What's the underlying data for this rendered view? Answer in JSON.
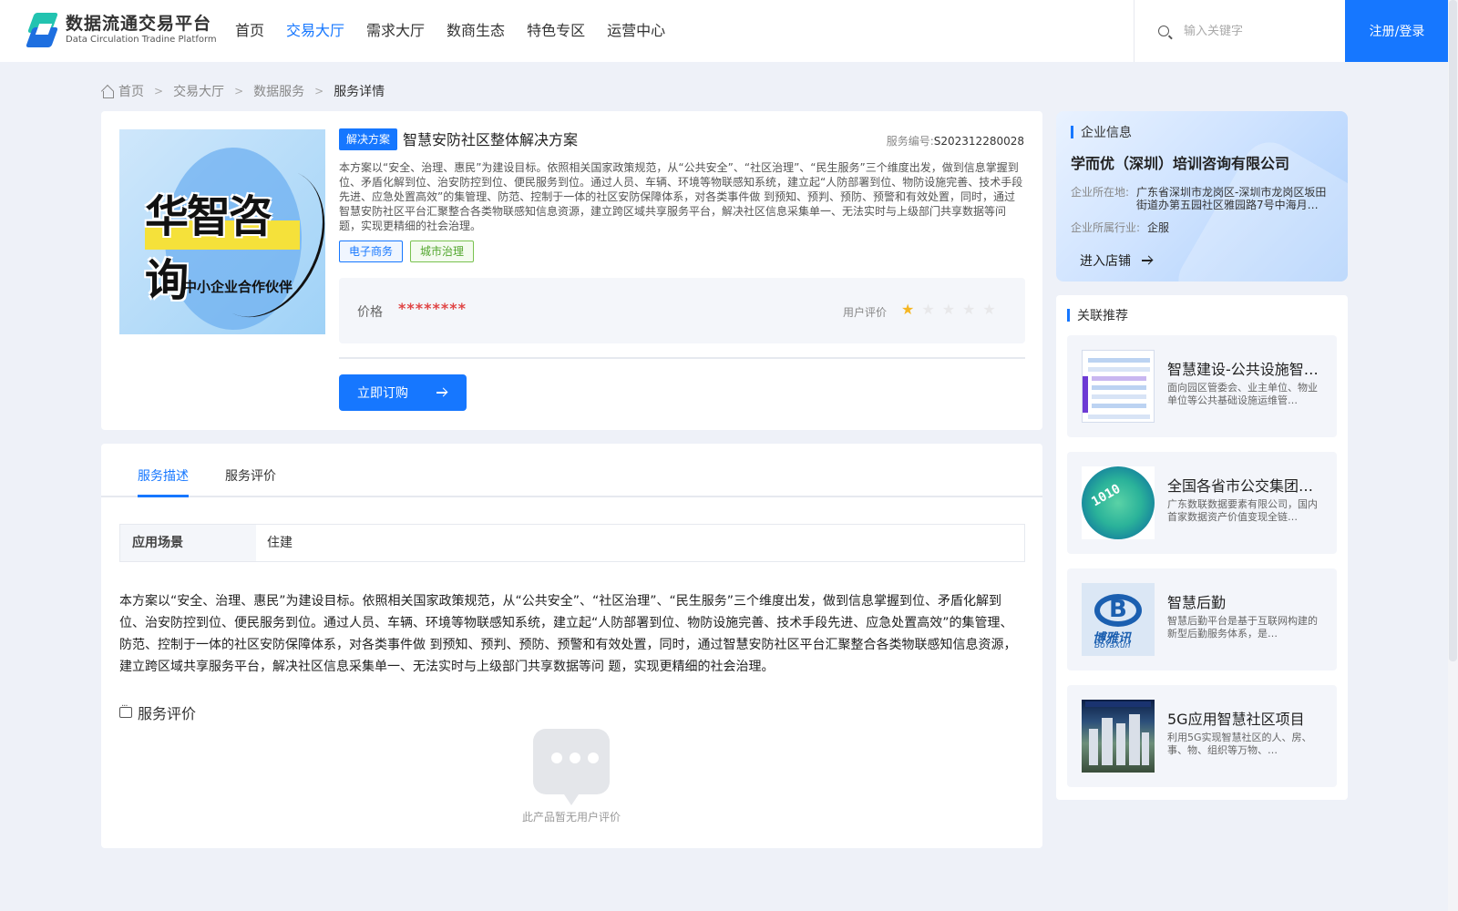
{
  "header": {
    "logo_cn": "数据流通交易平台",
    "logo_en": "Data Circulation Tradine Platform",
    "nav": [
      "首页",
      "交易大厅",
      "需求大厅",
      "数商生态",
      "特色专区",
      "运营中心"
    ],
    "active_nav": "交易大厅",
    "search_placeholder": "输入关键字",
    "login_label": "注册/登录",
    "accent_color": "#1677ff"
  },
  "breadcrumb": {
    "home": "首页",
    "items": [
      "交易大厅",
      "数据服务",
      "服务详情"
    ],
    "separator": ">"
  },
  "product": {
    "image_title": "华智咨询",
    "image_subtitle": "中小企业合作伙伴",
    "badge": "解决方案",
    "title": "智慧安防社区整体解决方案",
    "service_no_label": "服务编号:",
    "service_no": "S202312280028",
    "description": "本方案以“安全、治理、惠民”为建设目标。依照相关国家政策规范，从“公共安全”、“社区治理”、“民生服务”三个维度出发，做到信息掌握到位、矛盾化解到位、治安防控到位、便民服务到位。通过人员、车辆、环境等物联感知系统，建立起“人防部署到位、物防设施完善、技术手段先进、应急处置高效”的集管理、防范、控制于一体的社区安防保障体系，对各类事件做 到预知、预判、预防、预警和有效处置，同时，通过智慧安防社区平台汇聚整合各类物联感知信息资源，建立跨区域共享服务平台，解决社区信息采集单一、无法实时与上级部门共享数据等问 题，实现更精细的社会治理。",
    "tags": [
      "电子商务",
      "城市治理"
    ],
    "price_label": "价格",
    "price_value": "********",
    "rating_label": "用户评价",
    "rating_stars": 1,
    "rating_max": 5,
    "buy_label": "立即订购"
  },
  "detail": {
    "tabs": [
      "服务描述",
      "服务评价"
    ],
    "active_tab": "服务描述",
    "scene_label": "应用场景",
    "scene_value": "住建",
    "description": "本方案以“安全、治理、惠民”为建设目标。依照相关国家政策规范，从“公共安全”、“社区治理”、“民生服务”三个维度出发，做到信息掌握到位、矛盾化解到位、治安防控到位、便民服务到位。通过人员、车辆、环境等物联感知系统，建立起“人防部署到位、物防设施完善、技术手段先进、应急处置高效”的集管理、防范、控制于一体的社区安防保障体系，对各类事件做 到预知、预判、预防、预警和有效处置，同时，通过智慧安防社区平台汇聚整合各类物联感知信息资源，建立跨区域共享服务平台，解决社区信息采集单一、无法实时与上级部门共享数据等问 题，实现更精细的社会治理。",
    "review_title": "服务评价",
    "empty_text": "此产品暂无用户评价"
  },
  "company": {
    "section_title": "企业信息",
    "name": "学而优（深圳）培训咨询有限公司",
    "location_label": "企业所在地:",
    "location": "广东省深圳市龙岗区-深圳市龙岗区坂田街道办第五园社区雅园路7号中海月朗苑…",
    "industry_label": "企业所属行业:",
    "industry": "企服",
    "enter_label": "进入店铺"
  },
  "recommend": {
    "section_title": "关联推荐",
    "items": [
      {
        "name": "智慧建设-公共设施智…",
        "desc": "面向园区管委会、业主单位、物业单位等公共基础设施运维管…",
        "thumb": "table"
      },
      {
        "name": "全国各省市公交集团…",
        "desc": "广东数联数据要素有限公司，国内首家数据资产价值变现全链…",
        "thumb": "globe",
        "thumb_text": "1010"
      },
      {
        "name": "智慧后勤",
        "desc": "智慧后勤平台是基于互联网构建的新型后勤服务体系，是…",
        "thumb": "logo",
        "thumb_letter": "B",
        "thumb_cn": "博雅讯",
        "thumb_en": "BoYaXun"
      },
      {
        "name": "5G应用智慧社区项目",
        "desc": "利用5G实现智慧社区的人、房、事、物、组织等万物、…",
        "thumb": "city"
      }
    ]
  }
}
